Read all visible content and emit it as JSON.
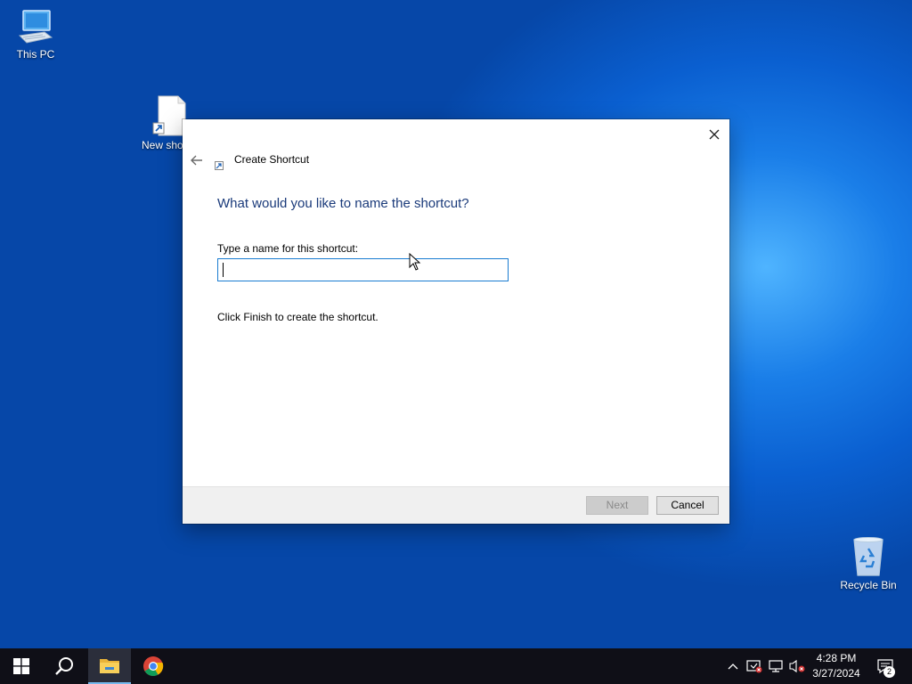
{
  "desktop": {
    "icons": [
      {
        "label": "This PC"
      },
      {
        "label": "New shortcut"
      },
      {
        "label": "Recycle Bin"
      }
    ]
  },
  "dialog": {
    "title": "Create Shortcut",
    "heading": "What would you like to name the shortcut?",
    "field_label": "Type a name for this shortcut:",
    "name_value": "",
    "instruction": "Click Finish to create the shortcut.",
    "next_label": "Next",
    "cancel_label": "Cancel"
  },
  "taskbar": {
    "clock_time": "4:28 PM",
    "clock_date": "3/27/2024",
    "notification_count": "2",
    "pinned": [
      "start-icon",
      "search-icon",
      "file-explorer-icon",
      "chrome-icon"
    ],
    "tray": [
      "chevron-up-icon",
      "security-icon",
      "network-icon",
      "volume-muted-icon",
      "action-center-icon"
    ]
  },
  "colors": {
    "accent": "#1a7cd1",
    "heading": "#1a3a7a",
    "taskbar": "#0f0f17",
    "desktop": "#0a5cc8"
  }
}
